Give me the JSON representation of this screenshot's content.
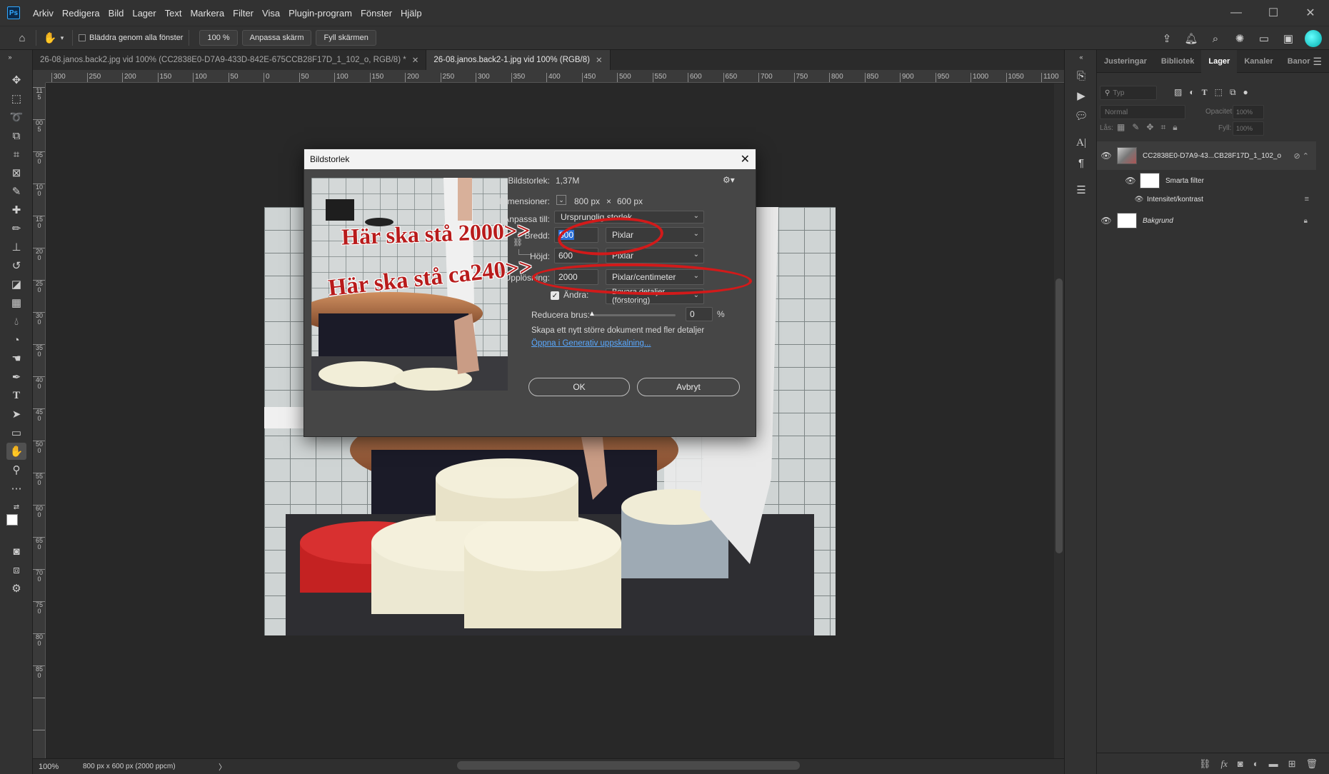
{
  "app": {
    "logo": "Ps",
    "menu": [
      "Arkiv",
      "Redigera",
      "Bild",
      "Lager",
      "Text",
      "Markera",
      "Filter",
      "Visa",
      "Plugin-program",
      "Fönster",
      "Hjälp"
    ],
    "window_controls": [
      "—",
      "☐",
      "✕"
    ]
  },
  "options_bar": {
    "scroll_all_label": "Bläddra genom alla fönster",
    "zoom_value": "100 %",
    "fit_screen_label": "Anpassa skärm",
    "fill_screen_label": "Fyll skärmen"
  },
  "tabs": [
    {
      "label": "26-08.janos.back2.jpg vid 100% (CC2838E0-D7A9-433D-842E-675CCB28F17D_1_102_o, RGB/8) *",
      "active": false
    },
    {
      "label": "26-08.janos.back2-1.jpg vid 100% (RGB/8)",
      "active": true
    }
  ],
  "ruler": {
    "h_labels": [
      "300",
      "250",
      "200",
      "150",
      "100",
      "50",
      "0",
      "50",
      "100",
      "150",
      "200",
      "250",
      "300",
      "350",
      "400",
      "450",
      "500",
      "550",
      "600",
      "650",
      "700",
      "750",
      "800",
      "850",
      "900",
      "950",
      "1000",
      "1050",
      "1100"
    ],
    "v_labels": [
      "1",
      "1",
      "5",
      "0",
      "0",
      "5",
      "0",
      "5",
      "0",
      "1",
      "0",
      "0",
      "1",
      "5",
      "0",
      "2",
      "0",
      "0",
      "2",
      "5",
      "0",
      "3",
      "0",
      "0",
      "3",
      "5",
      "0",
      "4",
      "0",
      "0",
      "4",
      "5",
      "0",
      "5",
      "0",
      "0",
      "5",
      "5",
      "0",
      "6",
      "0",
      "0",
      "6",
      "5",
      "0",
      "7",
      "0",
      "0",
      "7",
      "5",
      "0",
      "8",
      "0",
      "0",
      "8",
      "5",
      "0"
    ]
  },
  "status": {
    "zoom": "100%",
    "doc_info": "800 px x 600 px (2000 ppcm)",
    "arrow": "〉"
  },
  "dialog": {
    "title": "Bildstorlek",
    "image_size_label": "Bildstorlek:",
    "image_size_value": "1,37M",
    "dimensions_label": "Dimensioner:",
    "dimensions_w": "800 px",
    "dimensions_x": "×",
    "dimensions_h": "600 px",
    "fit_to_label": "Anpassa till:",
    "fit_to_value": "Ursprunglig storlek",
    "width_label": "Bredd:",
    "width_value": "800",
    "width_unit": "Pixlar",
    "height_label": "Höjd:",
    "height_value": "600",
    "height_unit": "Pixlar",
    "resolution_label": "Upplösning:",
    "resolution_value": "2000",
    "resolution_unit": "Pixlar/centimeter",
    "resample_label": "Ändra:",
    "resample_checked": true,
    "resample_value": "Bevara detaljer (förstoring)",
    "noise_label": "Reducera brus:",
    "noise_value": "0",
    "noise_unit": "%",
    "info_text": "Skapa ett nytt större dokument med fler detaljer",
    "link_text": "Öppna i Generativ uppskalning...",
    "ok_label": "OK",
    "cancel_label": "Avbryt"
  },
  "annotations": {
    "width_note": "Här ska stå 2000>>",
    "resolution_note": "Här ska stå ca240>>",
    "color": "#b81b1b"
  },
  "layers_panel": {
    "tabs": [
      "Justeringar",
      "Bibliotek",
      "Lager",
      "Kanaler",
      "Banor"
    ],
    "active_tab": "Lager",
    "search_placeholder": "Typ",
    "blend_mode": "Normal",
    "opacity_label": "Opacitet:",
    "opacity_value": "100%",
    "lock_label": "Lås:",
    "fill_label": "Fyll:",
    "fill_value": "100%",
    "layers": [
      {
        "name": "CC2838E0-D7A9-43...CB28F17D_1_102_o",
        "type": "smart-object"
      },
      {
        "name": "Smarta filter",
        "type": "filter-group"
      },
      {
        "name": "Intensitet/kontrast",
        "type": "filter"
      },
      {
        "name": "Bakgrund",
        "type": "background"
      }
    ]
  }
}
